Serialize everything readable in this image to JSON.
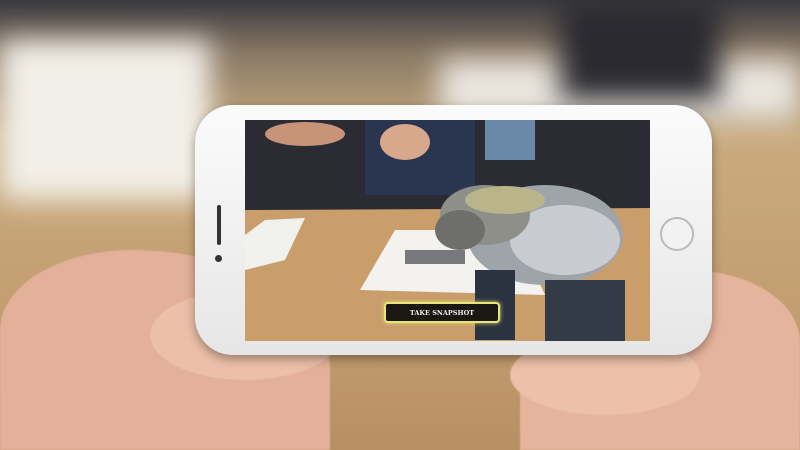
{
  "scene": {
    "snapshot_button_label": "TAKE SNAPSHOT",
    "colors": {
      "phone_body": "#f4f4f4",
      "button_border": "#e8e67a",
      "table": "#c9a070"
    }
  }
}
